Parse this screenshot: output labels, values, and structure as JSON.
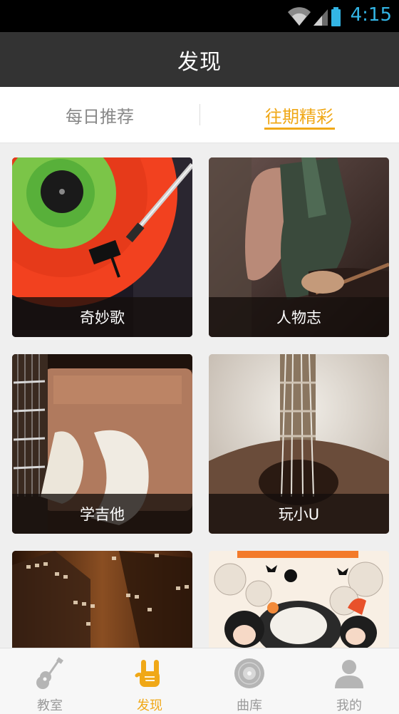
{
  "status_bar": {
    "time": "4:15",
    "icons": [
      "wifi-icon",
      "signal-icon",
      "battery-icon"
    ]
  },
  "header": {
    "title": "发现"
  },
  "tabs": [
    {
      "label": "每日推荐",
      "active": false
    },
    {
      "label": "往期精彩",
      "active": true
    }
  ],
  "cards": [
    {
      "caption": "奇妙歌"
    },
    {
      "caption": "人物志"
    },
    {
      "caption": "学吉他"
    },
    {
      "caption": "玩小U"
    }
  ],
  "bottom_nav": [
    {
      "label": "教室",
      "icon": "guitar-icon",
      "active": false
    },
    {
      "label": "发现",
      "icon": "rock-hand-icon",
      "active": true
    },
    {
      "label": "曲库",
      "icon": "vinyl-disc-icon",
      "active": false
    },
    {
      "label": "我的",
      "icon": "user-icon",
      "active": false
    }
  ],
  "colors": {
    "accent": "#f0a817",
    "app_bar": "#333333",
    "status_bar": "#000000",
    "clock": "#33b5e5"
  }
}
